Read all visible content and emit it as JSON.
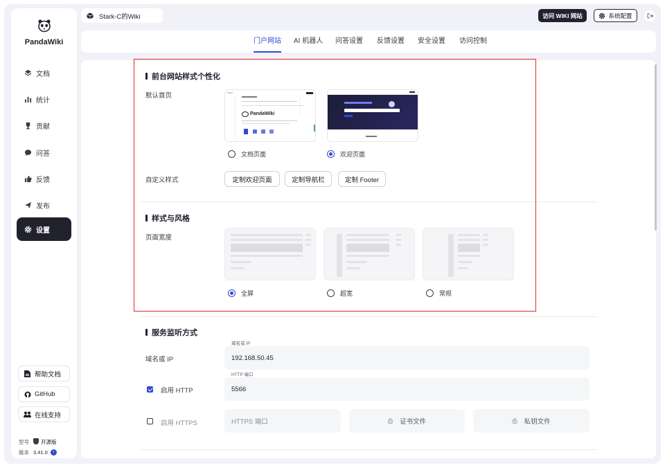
{
  "brand": {
    "name": "PandaWiki"
  },
  "sidebar": {
    "items": [
      {
        "label": "文档",
        "icon": "layers-icon"
      },
      {
        "label": "统计",
        "icon": "bar-chart-icon"
      },
      {
        "label": "贡献",
        "icon": "trophy-icon"
      },
      {
        "label": "问答",
        "icon": "chat-icon"
      },
      {
        "label": "反馈",
        "icon": "thumb-icon"
      },
      {
        "label": "发布",
        "icon": "send-icon"
      },
      {
        "label": "设置",
        "icon": "gear-icon",
        "active": true
      }
    ],
    "bottom": [
      {
        "label": "帮助文档",
        "icon": "doc-icon"
      },
      {
        "label": "GitHub",
        "icon": "github-icon"
      },
      {
        "label": "在线支持",
        "icon": "group-icon"
      }
    ],
    "model_label": "型号",
    "model_value": "开源版",
    "version_label": "版本",
    "version_value": "3.41.0"
  },
  "topbar": {
    "kb_name": "Stark-C的Wiki",
    "visit_wiki": "访问 WIKI 网站",
    "system_config": "系统配置"
  },
  "tabs": [
    {
      "label": "门户网站",
      "active": true
    },
    {
      "label": "AI 机器人"
    },
    {
      "label": "问答设置"
    },
    {
      "label": "反馈设置"
    },
    {
      "label": "安全设置"
    },
    {
      "label": "访问控制"
    }
  ],
  "personalize": {
    "title": "前台网站样式个性化",
    "home_label": "默认首页",
    "home_options": [
      "文档页面",
      "欢迎页面"
    ],
    "home_selected": "欢迎页面",
    "preview_doc_brand": "PandaWiki",
    "custom_label": "自定义样式",
    "custom_buttons": [
      "定制欢迎页面",
      "定制导航栏",
      "定制 Footer"
    ]
  },
  "style": {
    "title": "样式与风格",
    "width_label": "页面宽度",
    "width_options": [
      "全屏",
      "超宽",
      "常规"
    ],
    "width_selected": "全屏"
  },
  "service": {
    "title": "服务监听方式",
    "domain_label": "域名或 IP",
    "domain_float": "域名或 IP",
    "domain_value": "192.168.50.45",
    "http_label": "启用 HTTP",
    "http_float": "HTTP 端口",
    "http_value": "5566",
    "https_label": "启用 HTTPS",
    "https_placeholder": "HTTPS 端口",
    "cert_file": "证书文件",
    "key_file": "私钥文件"
  },
  "colors": {
    "accent": "#3248d6",
    "dark": "#21222d",
    "highlight": "#e0282e"
  }
}
